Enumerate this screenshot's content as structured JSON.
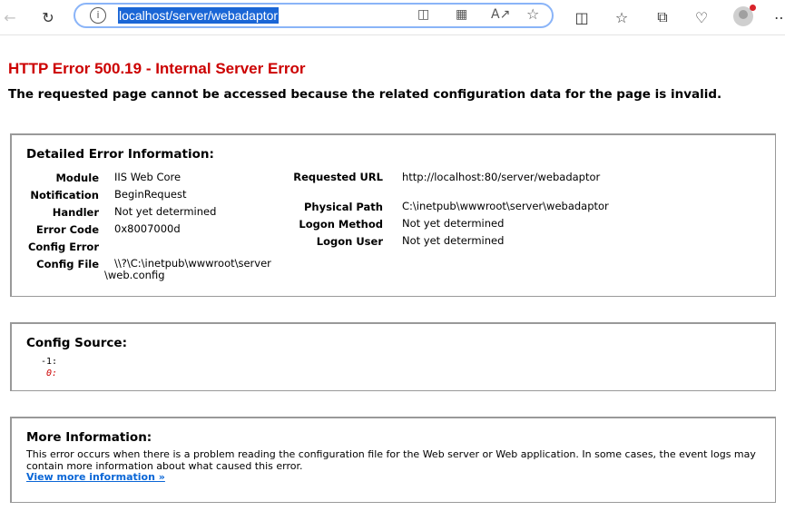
{
  "browser": {
    "address": "localhost/server/webadaptor",
    "icons": {
      "back": "back-arrow-icon",
      "refresh": "refresh-icon",
      "info": "info-icon",
      "app_available": "app-available-icon",
      "qr": "qr-code-icon",
      "read_aloud": "read-aloud-icon",
      "favorite": "star-icon",
      "split_screen": "split-screen-icon",
      "favorites": "favorites-icon",
      "collections": "collections-icon",
      "health": "browser-essentials-icon",
      "profile": "profile-icon",
      "more": "more-icon"
    }
  },
  "page": {
    "title": "HTTP Error 500.19 - Internal Server Error",
    "subtitle": "The requested page cannot be accessed because the related configuration data for the page is invalid."
  },
  "detail": {
    "heading": "Detailed Error Information:",
    "left": [
      {
        "label": "Module",
        "value": "IIS Web Core"
      },
      {
        "label": "Notification",
        "value": "BeginRequest"
      },
      {
        "label": "Handler",
        "value": "Not yet determined"
      },
      {
        "label": "Error Code",
        "value": "0x8007000d"
      },
      {
        "label": "Config Error",
        "value": ""
      },
      {
        "label": "Config File",
        "value": "\\\\?\\C:\\inetpub\\wwwroot\\server\\web.config"
      }
    ],
    "right": [
      {
        "label": "Requested URL",
        "value": "http://localhost:80/server/webadaptor"
      },
      {
        "label": "Physical Path",
        "value": "C:\\inetpub\\wwwroot\\server\\webadaptor"
      },
      {
        "label": "Logon Method",
        "value": "Not yet determined"
      },
      {
        "label": "Logon User",
        "value": "Not yet determined"
      }
    ]
  },
  "config_source": {
    "heading": "Config Source:",
    "lines": [
      {
        "num": "-1:",
        "text": ""
      },
      {
        "num": "0:",
        "text": ""
      }
    ]
  },
  "more_info": {
    "heading": "More Information:",
    "text": "This error occurs when there is a problem reading the configuration file for the Web server or Web application. In some cases, the event logs may contain more information about what caused this error.",
    "link": "View more information »"
  },
  "colors": {
    "title": "#cc0000",
    "link": "#0a66d6",
    "selection": "#1a66d6",
    "box_border": "#999999"
  }
}
